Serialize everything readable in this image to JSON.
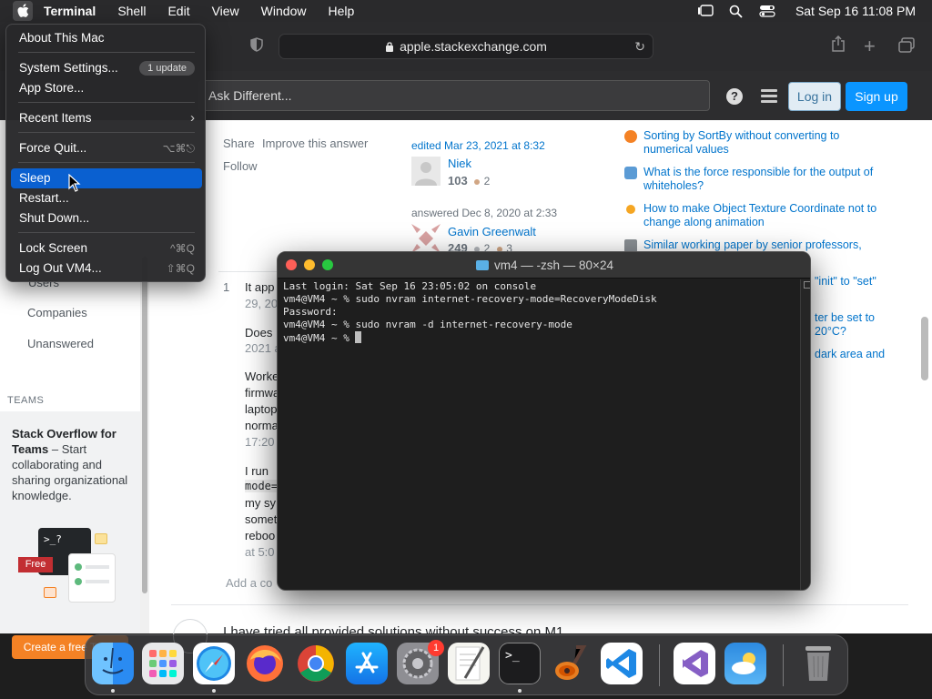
{
  "menubar": {
    "app_name": "Terminal",
    "items": [
      "Shell",
      "Edit",
      "View",
      "Window",
      "Help"
    ],
    "clock": "Sat Sep 16  11:08 PM"
  },
  "browser": {
    "url": "apple.stackexchange.com",
    "search_placeholder": "Ask Different...",
    "login_label": "Log in",
    "signup_label": "Sign up"
  },
  "leftnav": {
    "users": "Users",
    "companies": "Companies",
    "unanswered": "Unanswered",
    "teams_label": "TEAMS",
    "teams_title": "Stack Overflow for Teams",
    "teams_desc": " – Start collaborating and sharing organizational knowledge.",
    "free_badge": "Free",
    "create_team": "Create a free Team"
  },
  "answer": {
    "share": "Share",
    "improve": "Improve this answer",
    "follow": "Follow",
    "edited": "edited Mar 23, 2021 at 8:32",
    "editor_name": "Niek",
    "editor_rep": "103",
    "editor_bronze": "2",
    "answered": "answered Dec 8, 2020 at 2:33",
    "author_name": "Gavin Greenwalt",
    "author_rep": "249",
    "author_silver": "2",
    "author_bronze": "3"
  },
  "comments": {
    "vote": "1",
    "c1_line1": "It app",
    "c1_line2": "29, 202",
    "c2_line1": "Does",
    "c2_line2": "2021 a",
    "c3_line1": "Worke",
    "c3_line2": "firmwa",
    "c3_line3": "laptop",
    "c3_line4": "norma",
    "c3_line5": "17:20",
    "c4_line1": "I run",
    "c4_line2": "mode=",
    "c4_line3": "my sy",
    "c4_line4": "somet",
    "c4_line5": "reboo",
    "c4_line6": "at 5:0",
    "add_comment": "Add a co",
    "next_answer": "I have tried all provided solutions without success on M1"
  },
  "hot_questions": [
    "Sorting by SortBy without converting to numerical values",
    "What is the force responsible for the output of whiteholes?",
    "How to make Object Texture Coordinate not to change along animation",
    "Similar working paper by senior professors,",
    "\"init\" to \"set\"",
    "ter be set to",
    "20°C?",
    "dark area and"
  ],
  "apple_menu": {
    "about": "About This Mac",
    "settings": "System Settings...",
    "settings_badge": "1 update",
    "appstore": "App Store...",
    "recent": "Recent Items",
    "forcequit": "Force Quit...",
    "forcequit_sc": "⌥⌘⎋",
    "sleep": "Sleep",
    "restart": "Restart...",
    "shutdown": "Shut Down...",
    "lock": "Lock Screen",
    "lock_sc": "^⌘Q",
    "logout": "Log Out VM4...",
    "logout_sc": "⇧⌘Q"
  },
  "terminal": {
    "title": "vm4 — -zsh — 80×24",
    "lines": [
      "Last login: Sat Sep 16 23:05:02 on console",
      "vm4@VM4 ~ % sudo nvram internet-recovery-mode=RecoveryModeDisk",
      "Password:",
      "vm4@VM4 ~ % sudo nvram -d internet-recovery-mode",
      "vm4@VM4 ~ % "
    ]
  },
  "dock": {
    "apps": [
      "Finder",
      "Launchpad",
      "Safari",
      "Firefox",
      "Chrome",
      "App Store",
      "System Settings",
      "TextEdit",
      "Terminal",
      "GarageBand",
      "Visual Studio Code",
      "Visual Studio",
      "Weather",
      "Trash"
    ],
    "settings_badge": "1"
  }
}
